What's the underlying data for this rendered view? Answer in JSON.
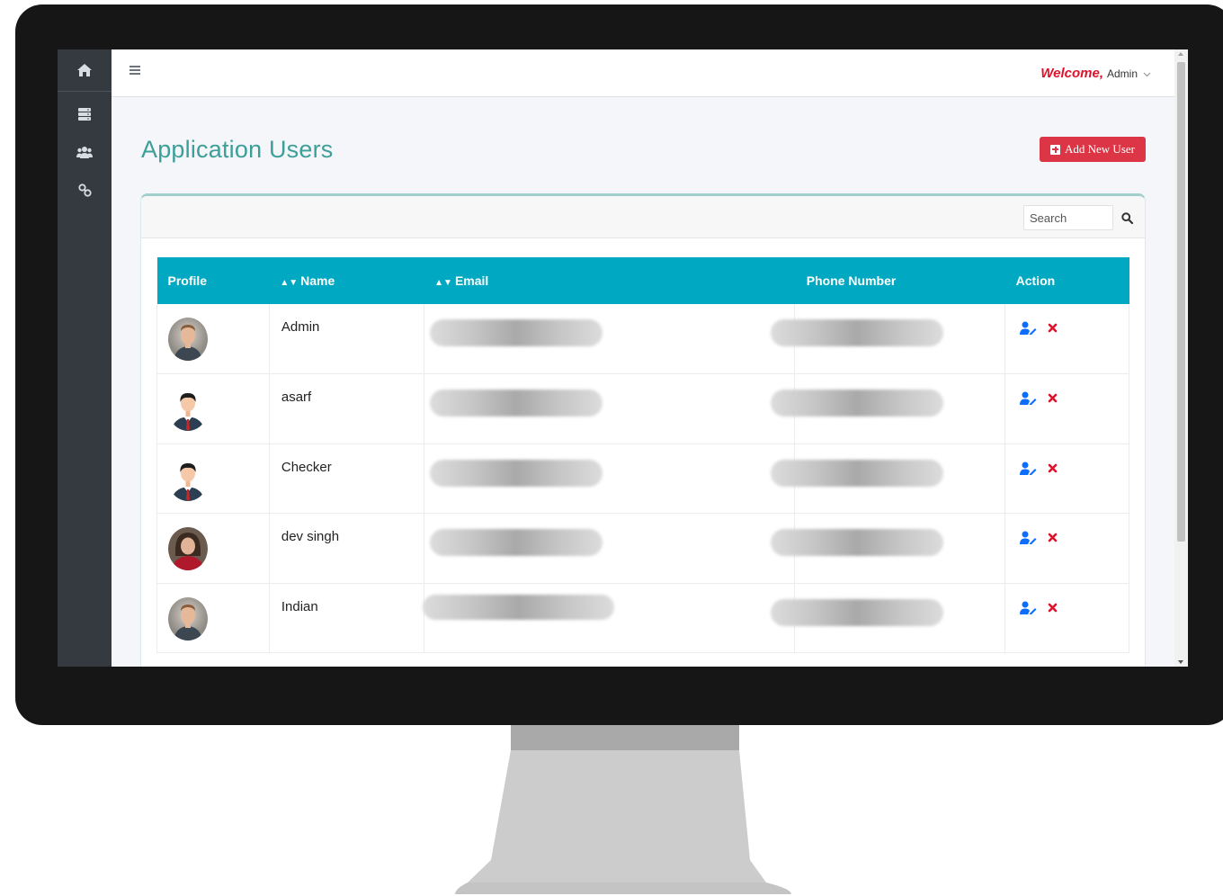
{
  "topbar": {
    "welcome": "Welcome,",
    "user": "Admin"
  },
  "page": {
    "title": "Application Users",
    "add_button": "Add New User"
  },
  "search": {
    "placeholder": "Search"
  },
  "table": {
    "columns": [
      "Profile",
      "Name",
      "Email",
      "Phone Number",
      "Action"
    ],
    "sortable": [
      "Name",
      "Email"
    ],
    "rows": [
      {
        "name": "Admin",
        "avatar": "photo-man"
      },
      {
        "name": "asarf",
        "avatar": "illustration-man"
      },
      {
        "name": "Checker",
        "avatar": "illustration-man"
      },
      {
        "name": "dev singh",
        "avatar": "photo-woman"
      },
      {
        "name": "Indian",
        "avatar": "photo-man"
      }
    ]
  },
  "sidebar": {
    "items": [
      "home-icon",
      "server-icon",
      "users-icon",
      "link-icon"
    ]
  },
  "colors": {
    "accent": "#00a8c2",
    "title": "#3d9e9a",
    "danger": "#dc3545",
    "sidebar": "#343a40",
    "edit_icon": "#0d6efd",
    "delete_icon": "#e0112b"
  }
}
